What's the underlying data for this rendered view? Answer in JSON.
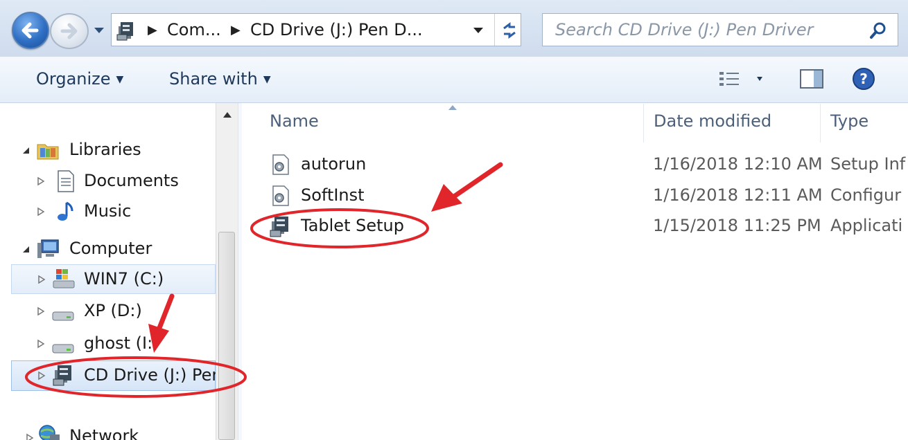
{
  "address_bar": {
    "crumbs": [
      "Com...",
      "CD Drive (J:) Pen D..."
    ]
  },
  "search": {
    "placeholder": "Search CD Drive (J:) Pen Driver"
  },
  "toolbar": {
    "organize": "Organize",
    "share_with": "Share with"
  },
  "nav_tree": {
    "libraries": "Libraries",
    "documents": "Documents",
    "music": "Music",
    "computer": "Computer",
    "win7": "WIN7 (C:)",
    "xp": "XP (D:)",
    "ghost": "ghost (I:)",
    "cd_drive": "CD Drive (J:) Pen",
    "network": "Network"
  },
  "columns": {
    "name": "Name",
    "date": "Date modified",
    "type": "Type"
  },
  "files": [
    {
      "name": "autorun",
      "date": "1/16/2018 12:10 AM",
      "type": "Setup Inf",
      "icon": "setup-info-icon"
    },
    {
      "name": "SoftInst",
      "date": "1/16/2018 12:11 AM",
      "type": "Configur",
      "icon": "config-settings-icon"
    },
    {
      "name": "Tablet Setup",
      "date": "1/15/2018 11:25 PM",
      "type": "Applicati",
      "icon": "setup-application-icon"
    }
  ],
  "annotation": {
    "color": "#e0262a"
  }
}
